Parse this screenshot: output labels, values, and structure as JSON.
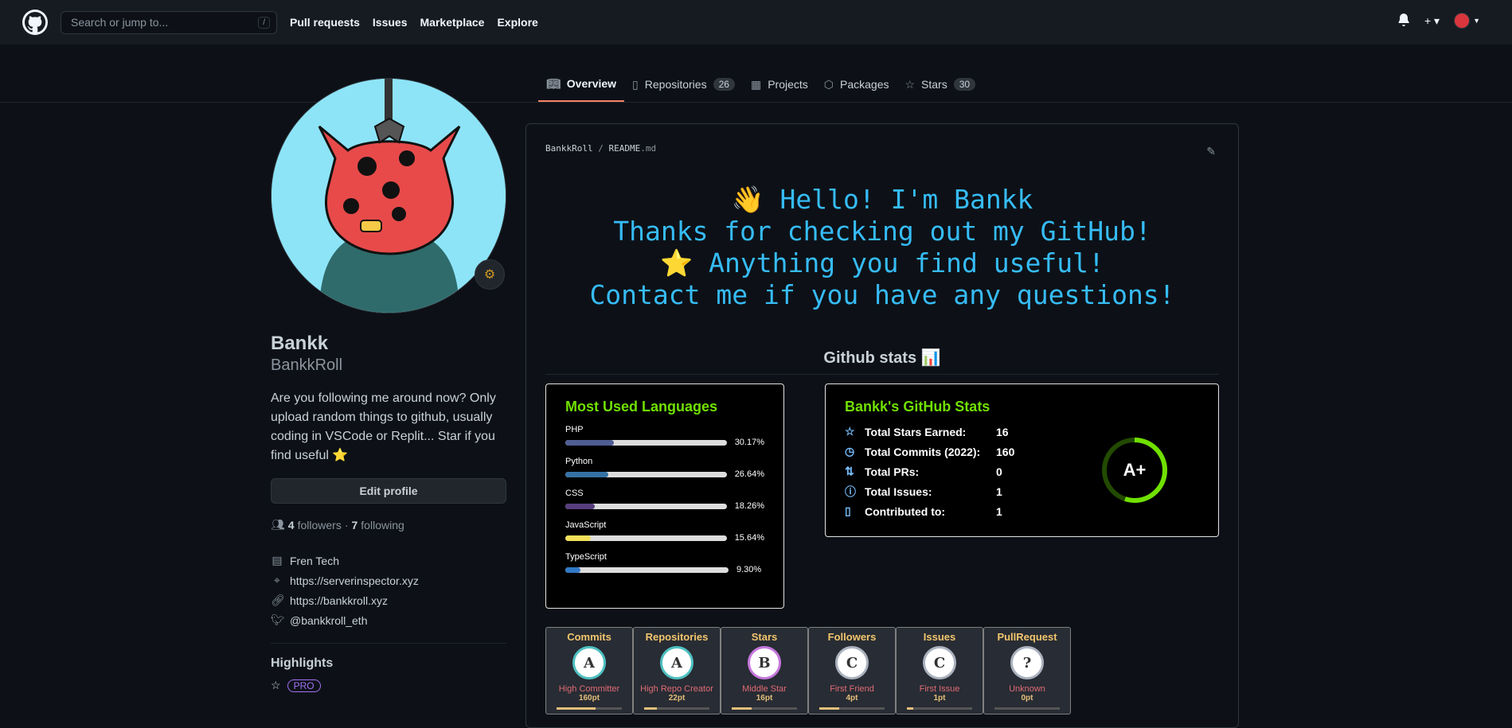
{
  "header": {
    "search_placeholder": "Search or jump to...",
    "slash_hint": "/",
    "nav": [
      "Pull requests",
      "Issues",
      "Marketplace",
      "Explore"
    ],
    "plus": "+ ▾"
  },
  "tabs": [
    {
      "label": "Overview",
      "count": ""
    },
    {
      "label": "Repositories",
      "count": "26"
    },
    {
      "label": "Projects",
      "count": ""
    },
    {
      "label": "Packages",
      "count": ""
    },
    {
      "label": "Stars",
      "count": "30"
    }
  ],
  "profile": {
    "name": "Bankk",
    "login": "BankkRoll",
    "bio": "Are you following me around now? Only upload random things to github, usually coding in VSCode or Replit... Star if you find useful ⭐",
    "edit_label": "Edit profile",
    "followers": "4",
    "followers_label": "followers",
    "following": "7",
    "following_label": "following",
    "company": "Fren Tech",
    "location": "https://serverinspector.xyz",
    "website": "https://bankkroll.xyz",
    "twitter": "@bankkroll_eth",
    "highlights_title": "Highlights",
    "pro_label": "PRO"
  },
  "readme": {
    "owner": "BankkRoll",
    "sep": "/",
    "file": "README",
    "ext": ".md",
    "hello_lines": [
      "👋 Hello! I'm Bankk",
      "Thanks for checking out my GitHub!",
      "⭐ Anything you find useful!",
      "Contact me if you have any questions!"
    ],
    "stats_title": "Github stats 📊"
  },
  "languages": {
    "title": "Most Used Languages",
    "items": [
      {
        "name": "PHP",
        "pct": "30.17%",
        "value": 30.17,
        "color": "#4F5D95"
      },
      {
        "name": "Python",
        "pct": "26.64%",
        "value": 26.64,
        "color": "#3572A5"
      },
      {
        "name": "CSS",
        "pct": "18.26%",
        "value": 18.26,
        "color": "#563d7c"
      },
      {
        "name": "JavaScript",
        "pct": "15.64%",
        "value": 15.64,
        "color": "#f1e05a"
      },
      {
        "name": "TypeScript",
        "pct": "9.30%",
        "value": 9.3,
        "color": "#3178c6"
      }
    ]
  },
  "gh_stats": {
    "title": "Bankk's GitHub Stats",
    "rows": [
      {
        "label": "Total Stars Earned:",
        "value": "16",
        "icon": "star-icon"
      },
      {
        "label": "Total Commits (2022):",
        "value": "160",
        "icon": "history-icon"
      },
      {
        "label": "Total PRs:",
        "value": "0",
        "icon": "pull-request-icon"
      },
      {
        "label": "Total Issues:",
        "value": "1",
        "icon": "issue-icon"
      },
      {
        "label": "Contributed to:",
        "value": "1",
        "icon": "repo-icon"
      }
    ],
    "grade": "A+",
    "grade_progress": 0.55
  },
  "trophies": [
    {
      "title": "Commits",
      "rank": "A",
      "name": "High Committer",
      "pt": "160pt",
      "color": "#4ec0c0",
      "progress": 0.6
    },
    {
      "title": "Repositories",
      "rank": "A",
      "name": "High Repo Creator",
      "pt": "22pt",
      "color": "#4ec0c0",
      "progress": 0.2
    },
    {
      "title": "Stars",
      "rank": "B",
      "name": "Middle Star",
      "pt": "16pt",
      "color": "#c678dd",
      "progress": 0.3
    },
    {
      "title": "Followers",
      "rank": "C",
      "name": "First Friend",
      "pt": "4pt",
      "color": "#abb2bf",
      "progress": 0.3
    },
    {
      "title": "Issues",
      "rank": "C",
      "name": "First Issue",
      "pt": "1pt",
      "color": "#abb2bf",
      "progress": 0.1
    },
    {
      "title": "PullRequest",
      "rank": "?",
      "name": "Unknown",
      "pt": "0pt",
      "color": "#abb2bf",
      "progress": 0.0
    }
  ]
}
